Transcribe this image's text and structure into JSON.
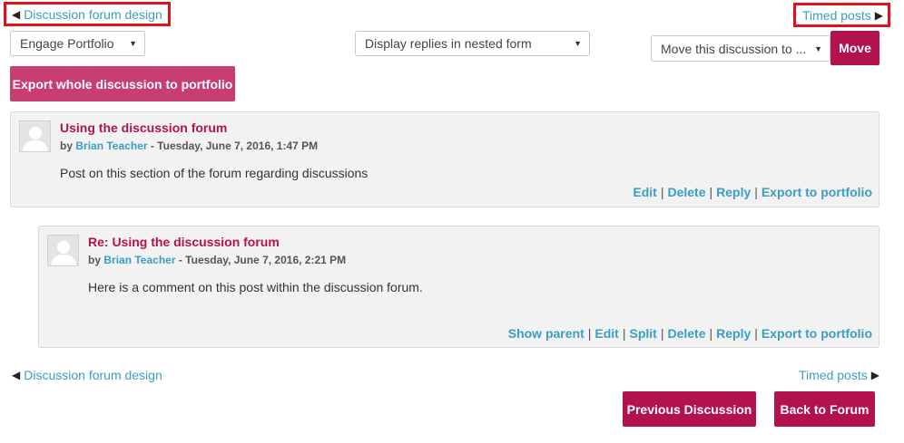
{
  "nav": {
    "prev_label": "Discussion forum design",
    "next_label": "Timed posts"
  },
  "toolbar": {
    "portfolio_select": "Engage Portfolio",
    "display_select": "Display replies in nested form",
    "move_select": "Move this discussion to ...",
    "move_button": "Move",
    "export_button": "Export whole discussion to portfolio"
  },
  "posts": [
    {
      "title": "Using the discussion forum",
      "by": "by",
      "author": "Brian Teacher",
      "date": " - Tuesday, June 7, 2016, 1:47 PM",
      "body": "Post on this section of the forum regarding discussions",
      "commands": [
        "Edit",
        "Delete",
        "Reply",
        "Export to portfolio"
      ]
    },
    {
      "title": "Re: Using the discussion forum",
      "by": "by",
      "author": "Brian Teacher",
      "date": " - Tuesday, June 7, 2016, 2:21 PM",
      "body": "Here is a comment on this post within the discussion forum.",
      "commands": [
        "Show parent",
        "Edit",
        "Split",
        "Delete",
        "Reply",
        "Export to portfolio"
      ]
    }
  ],
  "footer": {
    "prev_discussion_button": "Previous Discussion",
    "back_to_forum_button": "Back to Forum"
  },
  "colors": {
    "accent": "#b2134e",
    "link": "#3b9ec1",
    "highlight_box": "#e0111a"
  }
}
